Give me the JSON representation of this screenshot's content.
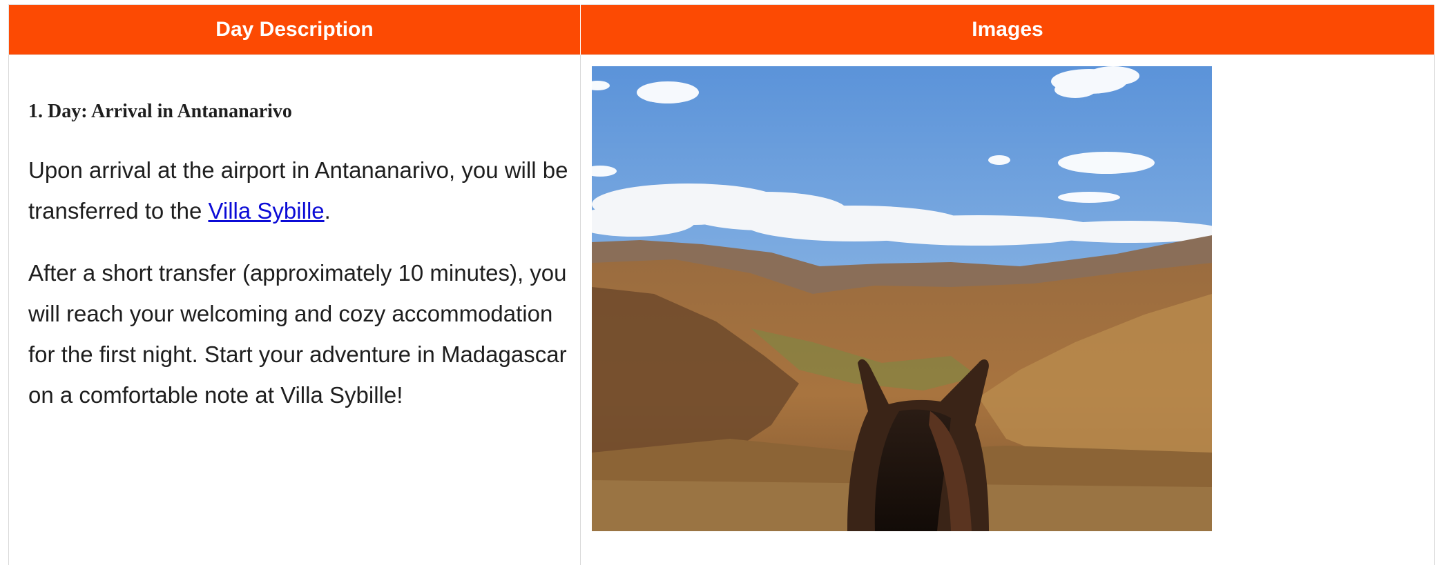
{
  "table": {
    "headers": {
      "description": "Day Description",
      "images": "Images"
    },
    "day": {
      "title": "1. Day: Arrival in Antananarivo",
      "paragraph1_before": "Upon arrival at the airport in Antananarivo, you will be transferred to the ",
      "link_text": "Villa Sybille",
      "paragraph1_after": ".",
      "paragraph2": "After a short transfer (approximately 10 minutes), you will reach your welcoming and cozy accommodation for the first night. Start your adventure in Madagascar on a comfortable note at Villa Sybille!"
    }
  },
  "colors": {
    "header_bg": "#fc4a03",
    "header_text": "#ffffff",
    "link": "#0b0bd6",
    "body_text": "#1e1e1e"
  }
}
